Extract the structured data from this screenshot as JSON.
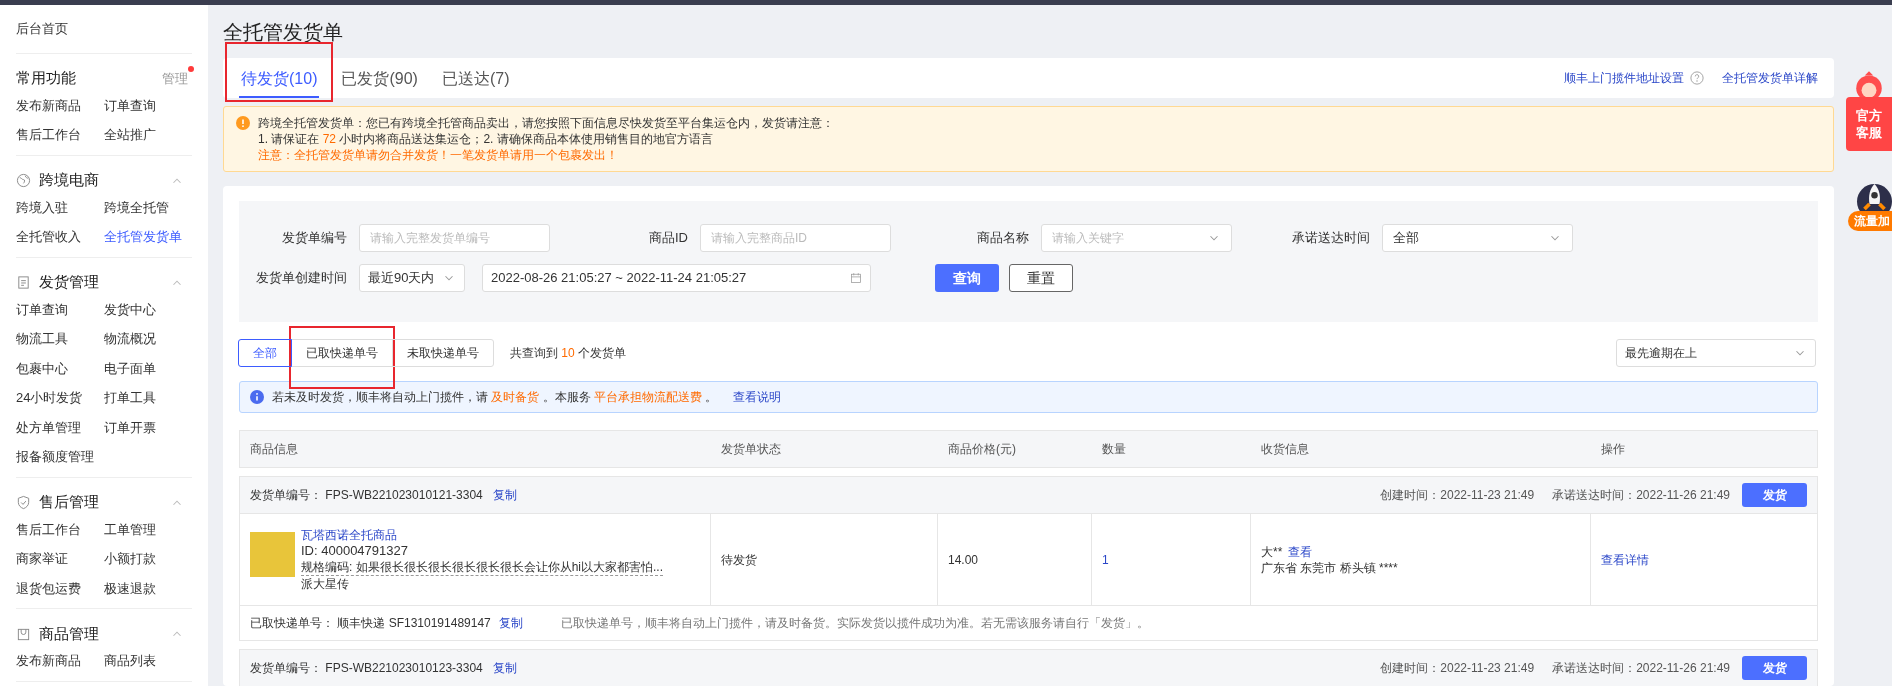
{
  "sidebar": {
    "home": "后台首页",
    "sections": [
      {
        "title": "常用功能",
        "manage": "管理",
        "manage_dot": true,
        "items": [
          {
            "label": "发布新商品",
            "selected": false
          },
          {
            "label": "订单查询",
            "selected": false
          },
          {
            "label": "售后工作台",
            "selected": false
          },
          {
            "label": "全站推广",
            "selected": false
          }
        ]
      },
      {
        "title": "跨境电商",
        "expanded": true,
        "items": [
          {
            "label": "跨境入驻",
            "selected": false
          },
          {
            "label": "跨境全托管",
            "selected": false
          },
          {
            "label": "全托管收入",
            "selected": false
          },
          {
            "label": "全托管发货单",
            "selected": true
          }
        ]
      },
      {
        "title": "发货管理",
        "expanded": true,
        "items": [
          {
            "label": "订单查询",
            "selected": false
          },
          {
            "label": "发货中心",
            "selected": false
          },
          {
            "label": "物流工具",
            "selected": false
          },
          {
            "label": "物流概况",
            "selected": false
          },
          {
            "label": "包裹中心",
            "selected": false
          },
          {
            "label": "电子面单",
            "selected": false
          },
          {
            "label": "24小时发货",
            "selected": false
          },
          {
            "label": "打单工具",
            "selected": false
          },
          {
            "label": "处方单管理",
            "selected": false
          },
          {
            "label": "订单开票",
            "selected": false
          },
          {
            "label": "报备额度管理",
            "selected": false
          }
        ]
      },
      {
        "title": "售后管理",
        "expanded": true,
        "items": [
          {
            "label": "售后工作台",
            "selected": false
          },
          {
            "label": "工单管理",
            "selected": false
          },
          {
            "label": "商家举证",
            "selected": false
          },
          {
            "label": "小额打款",
            "selected": false
          },
          {
            "label": "退货包运费",
            "selected": false
          },
          {
            "label": "极速退款",
            "selected": false
          }
        ]
      },
      {
        "title": "商品管理",
        "expanded": true,
        "items": [
          {
            "label": "发布新商品",
            "selected": false
          },
          {
            "label": "商品列表",
            "selected": false
          }
        ]
      }
    ]
  },
  "page_title": "全托管发货单",
  "tabs": [
    {
      "label": "待发货(10)",
      "selected": true,
      "highlighted": true
    },
    {
      "label": "已发货(90)",
      "selected": false,
      "highlighted": false
    },
    {
      "label": "已送达(7)",
      "selected": false,
      "highlighted": false
    }
  ],
  "tab_links": [
    {
      "label": "顺丰上门揽件地址设置",
      "help": true
    },
    {
      "label": "全托管发货单详解",
      "help": false
    }
  ],
  "alert": {
    "lines": [
      [
        {
          "text": "跨境全托管发货单：您已有跨境全托管商品卖出，请您按照下面信息尽快发货至平台集运仓内，发货请注意：",
          "emphasis": false
        }
      ],
      [
        {
          "text": "1. 请保证在",
          "emphasis": false
        },
        {
          "text": "72",
          "emphasis": true
        },
        {
          "text": "小时内将商品送达集运仓；2. 请确保商品本体使用销售目的地官方语言",
          "emphasis": false
        }
      ],
      [
        {
          "text": "注意：全托管发货单请勿合并发货！一笔发货单请用一个包裹发出！",
          "emphasis": true
        }
      ]
    ]
  },
  "filters": [
    {
      "kind": "text",
      "label": "发货单编号",
      "placeholder": "请输入完整发货单编号"
    },
    {
      "kind": "text",
      "label": "商品ID",
      "placeholder": "请输入完整商品ID"
    },
    {
      "kind": "select",
      "label": "商品名称",
      "placeholder": "请输入关键字"
    },
    {
      "kind": "select",
      "label": "承诺送达时间",
      "value": "全部"
    }
  ],
  "created_time": {
    "label": "发货单创建时间",
    "preset": "最近90天内",
    "range": "2022-08-26 21:05:27 ~ 2022-11-24 21:05:27"
  },
  "filter_buttons": [
    {
      "label": "查询",
      "primary": true
    },
    {
      "label": "重置",
      "primary": false
    }
  ],
  "segments": [
    {
      "label": "全部",
      "selected": true,
      "highlighted": false
    },
    {
      "label": "已取快递单号",
      "selected": false,
      "highlighted": true
    },
    {
      "label": "未取快递单号",
      "selected": false,
      "highlighted": false
    }
  ],
  "result_summary": [
    {
      "text": "共查询到",
      "emphasis": false
    },
    {
      "text": "10",
      "emphasis": true
    },
    {
      "text": "个发货单",
      "emphasis": false
    }
  ],
  "sort": "最先逾期在上",
  "notice": {
    "parts": [
      {
        "text": "若未及时发货，顺丰将自动上门揽件，请",
        "emphasis": false
      },
      {
        "text": "及时备货",
        "emphasis": true
      },
      {
        "text": "。本服务",
        "emphasis": false
      },
      {
        "text": "平台承担物流配送费",
        "emphasis": true
      },
      {
        "text": "。",
        "emphasis": false
      }
    ],
    "link": "查看说明"
  },
  "table": {
    "columns": [
      "商品信息",
      "发货单状态",
      "商品价格(元)",
      "数量",
      "收货信息",
      "操作"
    ],
    "orders": [
      {
        "number_label": "发货单编号：",
        "number": "FPS-WB221023010121-3304",
        "copy": "复制",
        "created": "创建时间：2022-11-23 21:49",
        "promised": "承诺送达时间：2022-11-26 21:49",
        "action": "发货",
        "product": {
          "name": "瓦塔西诺全托商品",
          "id": "ID: 400004791327",
          "spec": "规格编码: 如果很长很长很长很长很长很长会让你从hi以大家都害怕...",
          "shop": "派大星传"
        },
        "status": "待发货",
        "price": "14.00",
        "quantity": "1",
        "receiver": {
          "name": "大**",
          "view": "查看",
          "address": "广东省 东莞市 桥头镇 ****"
        },
        "operation": "查看详情",
        "express": {
          "label": "已取快递单号：",
          "carrier": "顺丰快递",
          "number": "SF1310191489147",
          "copy": "复制",
          "note": "已取快递单号，顺丰将自动上门揽件，请及时备货。实际发货以揽件成功为准。若无需该服务请自行「发货」。"
        }
      },
      {
        "number_label": "发货单编号：",
        "number": "FPS-WB221023010123-3304",
        "copy": "复制",
        "created": "创建时间：2022-11-23 21:49",
        "promised": "承诺送达时间：2022-11-26 21:49",
        "action": "发货"
      }
    ]
  },
  "floating": [
    {
      "kind": "service",
      "label": "官方客服"
    },
    {
      "kind": "boost",
      "label": "流量加"
    }
  ]
}
